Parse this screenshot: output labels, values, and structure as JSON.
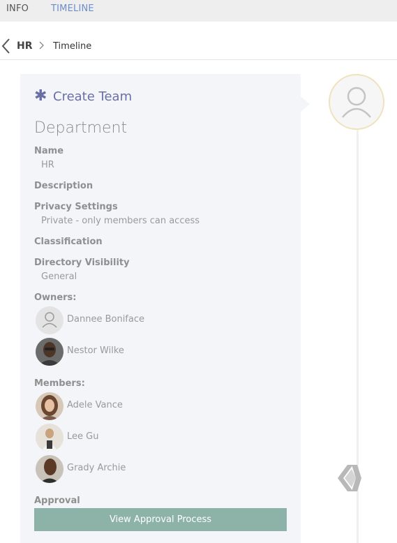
{
  "tabs": [
    {
      "label": "INFO",
      "active": false
    },
    {
      "label": "TIMELINE",
      "active": true
    }
  ],
  "breadcrumb": {
    "parent": "HR",
    "current": "Timeline"
  },
  "event": {
    "icon": "asterisk-icon",
    "title": "Create Team",
    "section_heading": "Department"
  },
  "fields": {
    "name_label": "Name",
    "name_value": "HR",
    "description_label": "Description",
    "privacy_label": "Privacy Settings",
    "privacy_value": "Private - only members can access",
    "classification_label": "Classification",
    "directory_label": "Directory Visibility",
    "directory_value": "General",
    "owners_label": "Owners:",
    "members_label": "Members:",
    "approval_label": "Approval"
  },
  "owners": [
    {
      "name": "Dannee Boniface",
      "avatar": "placeholder-avatar"
    },
    {
      "name": "Nestor Wilke",
      "avatar": "photo-avatar"
    }
  ],
  "members": [
    {
      "name": "Adele Vance",
      "avatar": "photo-avatar"
    },
    {
      "name": "Lee Gu",
      "avatar": "photo-avatar"
    },
    {
      "name": "Grady Archie",
      "avatar": "photo-avatar"
    }
  ],
  "actions": {
    "approval_button": "View Approval Process"
  },
  "colors": {
    "accent": "#6a6fa6",
    "tab_active": "#6c8fc8",
    "button": "#8db3a8",
    "card_bg": "#f4f5f9",
    "timeline_ring": "#efe2bd"
  }
}
